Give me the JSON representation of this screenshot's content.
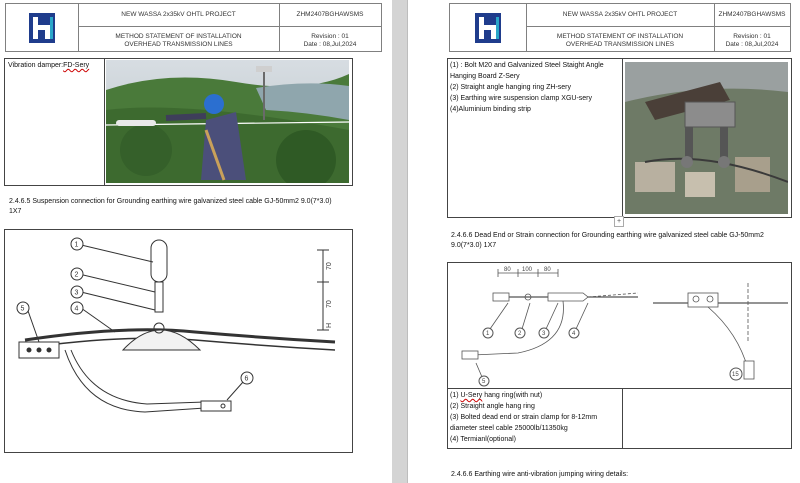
{
  "left_page": {
    "header": {
      "project": "NEW WASSA 2x35kV OHTL PROJECT",
      "doc_code": "ZHM2407BGHAWSMS",
      "title_line1": "METHOD STATEMENT OF INSTALLATION",
      "title_line2": "OVERHEAD TRANSMISSION LINES",
      "revision": "Revision : 01",
      "date": "Date : 08,Jul,2024"
    },
    "damper_label_prefix": "Vibration damper:",
    "damper_label_code": "FD-Sery",
    "section_2465_line1": "2.4.6.5 Suspension connection for Grounding earthing wire galvanized steel cable GJ-50mm2    9.0(7*3.0)",
    "section_2465_line2": "1X7",
    "drawing": {
      "callouts": [
        "1",
        "2",
        "3",
        "4",
        "5",
        "6"
      ],
      "dims": [
        "70",
        "70",
        "H"
      ]
    }
  },
  "right_page": {
    "header": {
      "project": "NEW WASSA 2x35kV OHTL PROJECT",
      "doc_code": "ZHM2407BGHAWSMS",
      "title_line1": "METHOD STATEMENT OF INSTALLATION",
      "title_line2": "OVERHEAD TRANSMISSION LINES",
      "revision": "Revision : 01",
      "date": "Date : 08,Jul,2024"
    },
    "hardware_list": [
      "(1) : Bolt M20 and Galvanized Steel Staight Angle",
      "Hanging Board Z-Sery",
      "(2)   Straight angle hanging ring ZH-sery",
      "(3) Earthing wire suspension clamp XGU-sery",
      "(4)Aluminium binding strip"
    ],
    "section_2466_line1": "2.4.6.6 Dead End or Strain connection for Grounding earthing wire galvanized steel cable GJ-50mm2",
    "section_2466_line2": "9.0(7*3.0) 1X7",
    "strain_drawing": {
      "dims": [
        "80",
        "100",
        "80"
      ],
      "callouts": [
        "1",
        "2",
        "3",
        "4",
        "5",
        "15"
      ]
    },
    "strain_list": [
      "(1)  U-Sery hang ring(with nut)",
      "(2)  Straight angle hang ring",
      "(3)  Bolted dead end or strain clamp for 8-12mm",
      "diameter steel cable 25000lb/11350kg",
      "(4)  Termianl(optional)"
    ],
    "section_2466b": "2.4.6.6 Earthing wire anti-vibration jumping wiring details:",
    "plus_glyph": "+"
  }
}
